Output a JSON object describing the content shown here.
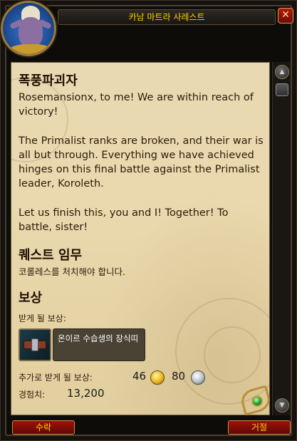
{
  "window": {
    "title": "카남 마트라 사레스트",
    "close_icon": "close-x-icon"
  },
  "quest": {
    "title": "폭풍파괴자",
    "description": [
      "Rosemansionx, to me! We are within reach of victory!",
      "The Primalist ranks are broken, and their war is all but through. Everything we have achieved hinges on this final battle against the Primalist leader, Koroleth.",
      "Let us finish this, you and I! Together! To battle, sister!"
    ],
    "objectives_heading": "퀘스트 임무",
    "objective_text": "코롤레스를 처치해야 합니다.",
    "rewards_heading": "보상",
    "receive_label": "받게 될 보상:",
    "reward_item": {
      "name": "온이르 수습생의 장식띠",
      "icon": "belt-icon"
    },
    "bonus_label": "추가로 받게 될 보상:",
    "gold": "46",
    "silver": "80",
    "xp_label": "경험치:",
    "xp_value": "13,200"
  },
  "buttons": {
    "accept": "수락",
    "decline": "거절"
  },
  "colors": {
    "title_text": "#ffd100",
    "parchment": "#e9d9b2",
    "button": "#9e1208"
  }
}
